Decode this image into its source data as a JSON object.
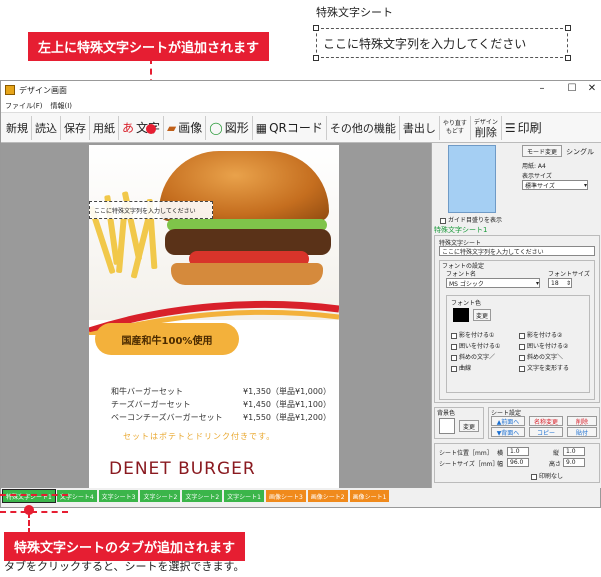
{
  "annotations": {
    "sample_title": "特殊文字シート",
    "sample_text": "ここに特殊文字列を入力してください",
    "top_callout": "左上に特殊文字シートが追加されます",
    "bottom_callout": "特殊文字シートのタブが追加されます",
    "bottom_text": "タブをクリックすると、シートを選択できます。"
  },
  "window": {
    "title": "デザイン画面",
    "controls": [
      "–",
      "☐",
      "✕"
    ],
    "menu": [
      "ファイル(F)",
      "情報(I)"
    ]
  },
  "toolbar": {
    "new": "新規",
    "read": "読込",
    "save": "保存",
    "paper": "用紙",
    "text_prefix": "あ",
    "text": "文字",
    "image": "画像",
    "shape": "図形",
    "qr": "QRコード",
    "other": "その他の機能",
    "export": "書出し",
    "redo": "やり直す",
    "undo": "もどす",
    "design_label": "デザイン",
    "delete": "削除",
    "print": "印刷"
  },
  "page": {
    "badge": "国産和牛100%使用",
    "menu": [
      {
        "name": "和牛バーガーセット",
        "price": "¥1,350（単品¥1,000）"
      },
      {
        "name": "チーズバーガーセット",
        "price": "¥1,450（単品¥1,100）"
      },
      {
        "name": "ベーコンチーズバーガーセット",
        "price": "¥1,550（単品¥1,200）"
      }
    ],
    "tagline": "セットはポテトとドリンク付きです。",
    "brand": "DENET BURGER",
    "selection_text": "ここに特殊文字列を入力してください"
  },
  "panel": {
    "mode_button": "モード変更",
    "mode_value": "シングル",
    "paper_label": "用紙: A4",
    "display_size_label": "表示サイズ",
    "display_size_value": "標準サイズ",
    "guide_label": "ガイド目盛りを表示",
    "current_sheet": "特殊文字シート1",
    "sheet_group_label": "特殊文字シート",
    "sheet_text": "ここに特殊文字列を入力してください",
    "font_settings_label": "フォントの設定",
    "font_name_label": "フォント名",
    "font_size_label": "フォントサイズ",
    "font_name_value": "MS ゴシック",
    "font_size_value": "18",
    "font_color_label": "フォント色",
    "font_color": "#000000",
    "change_button": "変更",
    "options_left": [
      "影を付ける①",
      "囲いを付ける①",
      "斜めの文字／",
      "曲線"
    ],
    "options_right": [
      "影を付ける②",
      "囲いを付ける②",
      "斜めの文字＼",
      "文字を変形する"
    ],
    "bg_label": "背景色",
    "bg_change": "変更",
    "sheet_setting_label": "シート設定",
    "front": "▲前面へ",
    "back": "▼背面へ",
    "rename": "名称変更",
    "copy": "コピー",
    "delete": "削除",
    "paste": "貼付",
    "pos_label": "シート位置［mm］",
    "pos_x_label": "横",
    "pos_x": "1.0",
    "pos_y_label": "縦",
    "pos_y": "1.0",
    "size_label": "シートサイズ［mm］",
    "width_label": "幅",
    "width": "96.0",
    "height_label": "高さ",
    "height": "9.0",
    "no_print_label": "印刷なし"
  },
  "tabs": [
    {
      "label": "特殊文字シート1",
      "color": "green"
    },
    {
      "label": "文字シート4",
      "color": "green"
    },
    {
      "label": "文字シート3",
      "color": "green"
    },
    {
      "label": "文字シート2",
      "color": "green"
    },
    {
      "label": "文字シート2",
      "color": "green"
    },
    {
      "label": "文字シート1",
      "color": "green"
    },
    {
      "label": "画像シート3",
      "color": "orange"
    },
    {
      "label": "画像シート2",
      "color": "orange"
    },
    {
      "label": "画像シート1",
      "color": "orange"
    }
  ],
  "colors": {
    "accent_red": "#e61e32",
    "tab_green": "#3bb54a",
    "tab_orange": "#f08a1c",
    "brand": "#8a1a20"
  }
}
